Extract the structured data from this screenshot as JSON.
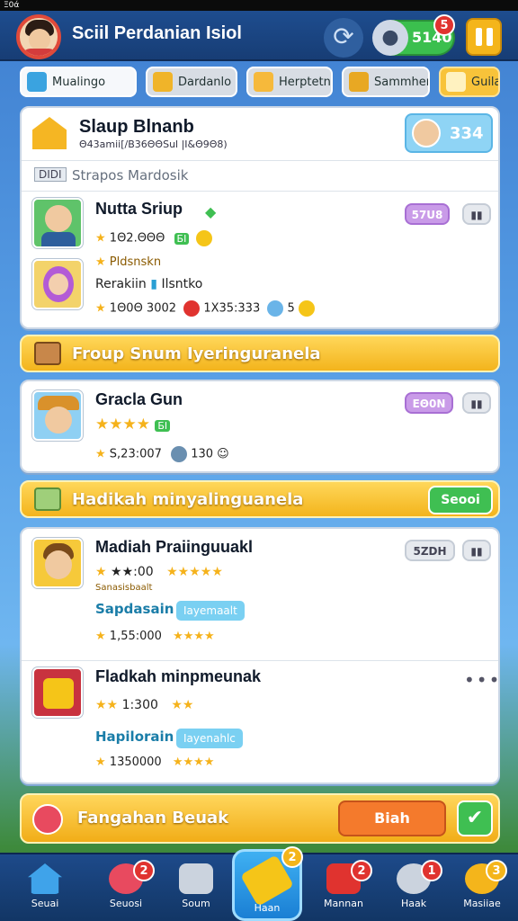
{
  "status_bar": {
    "text": "Ξ0ά"
  },
  "header": {
    "title": "Sciil Perdanian Isiol",
    "friends_count": "5140",
    "friends_badge": "5"
  },
  "tabs": [
    {
      "label": "Mualingo",
      "icon": "box-icon",
      "active": true
    },
    {
      "label": "Dardanlo",
      "icon": "chest-icon"
    },
    {
      "label": "Herptetn",
      "icon": "puzzle-icon"
    },
    {
      "label": "Sammhen",
      "icon": "treasure-icon"
    },
    {
      "label": "Guila",
      "icon": "house-icon",
      "gold": true
    }
  ],
  "player_card": {
    "name": "Slaup Blnanb",
    "subtitle": "Θ43amii[/Β36ΘΘSul |I&Θ9Θ8)",
    "score": "334",
    "section_label": "Strapos Mardosik",
    "section_tag": "DIDI",
    "rows": [
      {
        "name": "Nutta Sriup",
        "pill": "57U8",
        "stat": "1Θ2.ΘΘΘ",
        "stat_tag": "БI",
        "line2": "Pldsnskn",
        "line3_a": "Rerakiin",
        "line3_b": "Ilsntko",
        "line4_a": "1Θ0Θ 3002",
        "line4_b": "1Х35:333",
        "line4_c": "5"
      }
    ]
  },
  "banner1": {
    "text": "Froup Snum Iyeringuranela"
  },
  "card2": {
    "name": "Gracla Gun",
    "pill": "EΘ0N",
    "stat_tag": "БI",
    "stat": "S,23:007",
    "stat2": "130"
  },
  "banner2": {
    "text": "Hadikah minyalinguanela",
    "button": "Seooi"
  },
  "card3": {
    "rows": [
      {
        "name": "Madiah Praiinguuakl",
        "pill": "5ZDH",
        "stat": "★★:00",
        "sub_small": "Sanasisbaalt",
        "link": "Sapdasain",
        "chip": "Iayemaalt",
        "stat2": "1,55:000"
      },
      {
        "name": "Fladkah minpmeunak",
        "stat": "1:300",
        "link": "Hapilorain",
        "chip": "Iayenahlc",
        "stat2": "1350000"
      }
    ]
  },
  "claim_bar": {
    "text": "Fangahan Beuak",
    "button": "Biah"
  },
  "nav": [
    {
      "label": "Seuai",
      "icon": "home-icon"
    },
    {
      "label": "Seuosi",
      "icon": "chat-icon",
      "badge": "2"
    },
    {
      "label": "Soum",
      "icon": "gamepad-icon"
    },
    {
      "label": "Haan",
      "icon": "pencil-icon",
      "badge": "2"
    },
    {
      "label": "Mannan",
      "icon": "camera-icon",
      "badge": "2"
    },
    {
      "label": "Haak",
      "icon": "search-icon",
      "badge": "1"
    },
    {
      "label": "Masiiae",
      "icon": "gear-icon",
      "badge": "3"
    }
  ],
  "colors": {
    "accent": "#f4b51b",
    "primary": "#1e4d8f",
    "danger": "#e0332f",
    "success": "#3fbf52"
  }
}
